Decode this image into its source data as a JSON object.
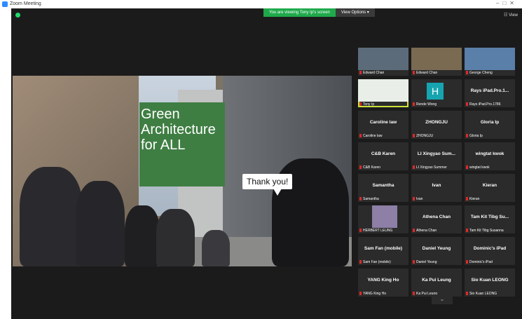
{
  "window": {
    "title": "Zoom Meeting"
  },
  "banner": {
    "message": "You are viewing Tony Ip's screen",
    "options": "View Options ▾"
  },
  "view_button": "☷ View",
  "slide": {
    "title": "Green Architecture for ALL",
    "speech": "Thank you!"
  },
  "participants": [
    {
      "name": "Edward Chan",
      "label": "Edward Chan",
      "video": true
    },
    {
      "name": "Edward Chan",
      "label": "Edward Chan",
      "video": true
    },
    {
      "name": "George Cheng",
      "label": "George Cheng",
      "video": true
    },
    {
      "name": "Tony Ip",
      "label": "Tony Ip",
      "video": true,
      "active": true
    },
    {
      "name": "H",
      "label": "Rende Wong",
      "avatar": "H"
    },
    {
      "name": "Rays iPad.Pro.1...",
      "label": "Rays iPad.Pro.1786"
    },
    {
      "name": "Caroline law",
      "label": "Caroline law"
    },
    {
      "name": "ZHONGJU",
      "label": "ZHONGJU"
    },
    {
      "name": "Gloria Ip",
      "label": "Gloria Ip"
    },
    {
      "name": "C&B Karen",
      "label": "C&B Karen"
    },
    {
      "name": "LI Xingyao Sum...",
      "label": "LI Xingyao Summer"
    },
    {
      "name": "wingtat kwok",
      "label": "wingtat kwok"
    },
    {
      "name": "Samantha",
      "label": "Samantha"
    },
    {
      "name": "Ivan",
      "label": "Ivan"
    },
    {
      "name": "Kieran",
      "label": "Kieran"
    },
    {
      "name": "",
      "label": "HERBERT LEUNG",
      "video": true
    },
    {
      "name": "Athena Chan",
      "label": "Athena Chan"
    },
    {
      "name": "Tam Kit Tibg Su...",
      "label": "Tam Kit Tibg Susanna"
    },
    {
      "name": "Sam Fan (mobile)",
      "label": "Sam Fan (mobile)"
    },
    {
      "name": "Daniel Yeung",
      "label": "Daniel Yeung"
    },
    {
      "name": "Dominic's iPad",
      "label": "Dominic's iPad"
    },
    {
      "name": "YANG King Ho",
      "label": "YANG King Ho"
    },
    {
      "name": "Ka Pui Leung",
      "label": "Ka Pui Leung"
    },
    {
      "name": "Sio Kuan LEONG",
      "label": "Sio Kuan LEONG"
    }
  ],
  "icons": {
    "titlebar": "zoom-icon",
    "security": "shield-icon",
    "more": "chevron-down-icon"
  }
}
